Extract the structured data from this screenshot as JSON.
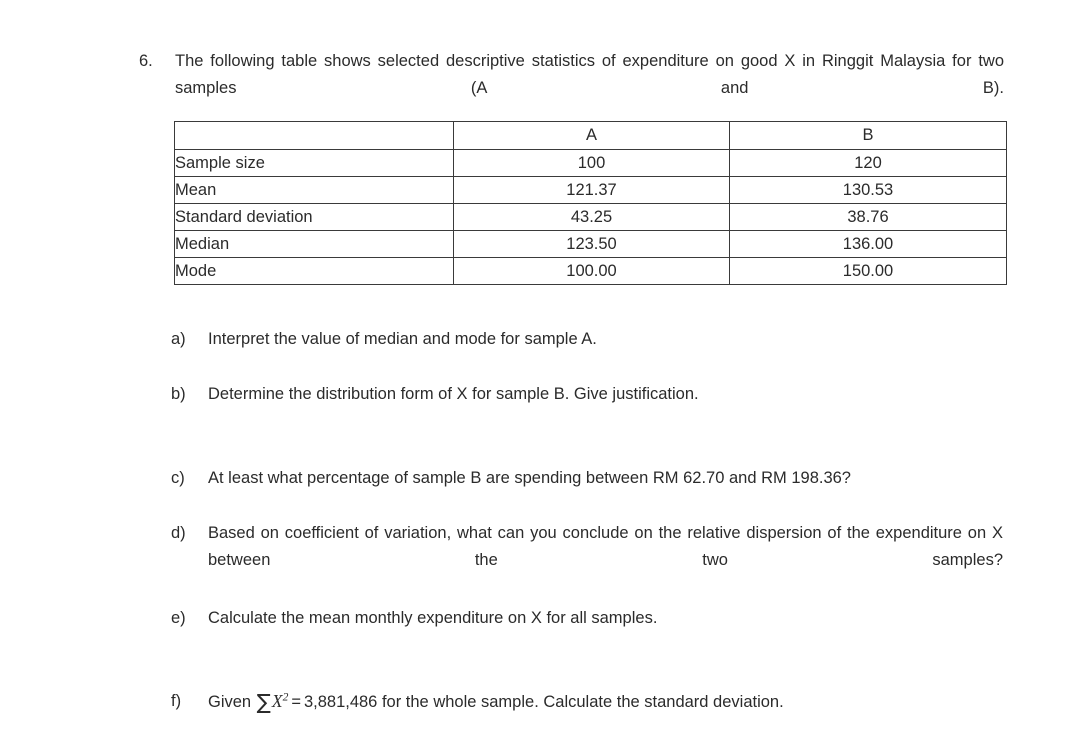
{
  "question": {
    "number": "6.",
    "stem": "The following table shows selected descriptive statistics of expenditure on good X in Ringgit Malaysia for two samples (A and B)."
  },
  "table": {
    "headers": [
      "",
      "A",
      "B"
    ],
    "rows": [
      {
        "label": "Sample size",
        "a": "100",
        "b": "120"
      },
      {
        "label": "Mean",
        "a": "121.37",
        "b": "130.53"
      },
      {
        "label": "Standard deviation",
        "a": "43.25",
        "b": "38.76"
      },
      {
        "label": "Median",
        "a": "123.50",
        "b": "136.00"
      },
      {
        "label": "Mode",
        "a": "100.00",
        "b": "150.00"
      }
    ]
  },
  "subquestions": [
    {
      "label": "a)",
      "text": "Interpret the value of median and mode for sample A."
    },
    {
      "label": "b)",
      "text": "Determine the distribution form of X for sample B. Give justification."
    },
    {
      "label": "c)",
      "text": "At least what percentage of sample B are spending between RM 62.70 and RM 198.36?"
    },
    {
      "label": "d)",
      "text": "Based on coefficient of variation, what can you conclude on the relative dispersion of the expenditure on X between the two samples?"
    },
    {
      "label": "e)",
      "text": "Calculate the mean monthly expenditure on X for all samples."
    },
    {
      "label": "f)",
      "text_before": "Given",
      "sum_symbol": "∑",
      "variable": "X",
      "exponent": "2",
      "equals": "=",
      "value": "3,881,486",
      "text_after": "for the whole sample.  Calculate the standard deviation."
    }
  ],
  "colors": {
    "text": "#2b2b2b",
    "border": "#3a3a3a",
    "background": "#ffffff"
  }
}
